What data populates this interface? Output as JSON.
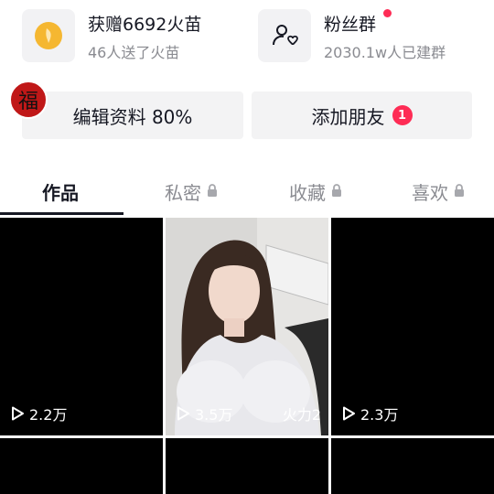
{
  "stats": {
    "fire": {
      "title": "获赠6692火苗",
      "sub": "46人送了火苗"
    },
    "fans": {
      "title": "粉丝群",
      "sub": "2030.1w人已建群"
    }
  },
  "avatar": {
    "char": "福"
  },
  "buttons": {
    "edit_profile": "编辑资料 80%",
    "add_friends": "添加朋友",
    "add_friends_badge": "1"
  },
  "tabs": [
    {
      "label": "作品",
      "locked": false,
      "active": true
    },
    {
      "label": "私密",
      "locked": true,
      "active": false
    },
    {
      "label": "收藏",
      "locked": true,
      "active": false
    },
    {
      "label": "喜欢",
      "locked": true,
      "active": false
    }
  ],
  "videos": [
    {
      "plays": "2.2万",
      "fire": ""
    },
    {
      "plays": "3.5万",
      "fire": "火力2"
    },
    {
      "plays": "2.3万",
      "fire": ""
    }
  ],
  "colors": {
    "accent": "#fe2c55",
    "notification_dot": "#fe2c55",
    "fire_icon": "#f5b731"
  }
}
